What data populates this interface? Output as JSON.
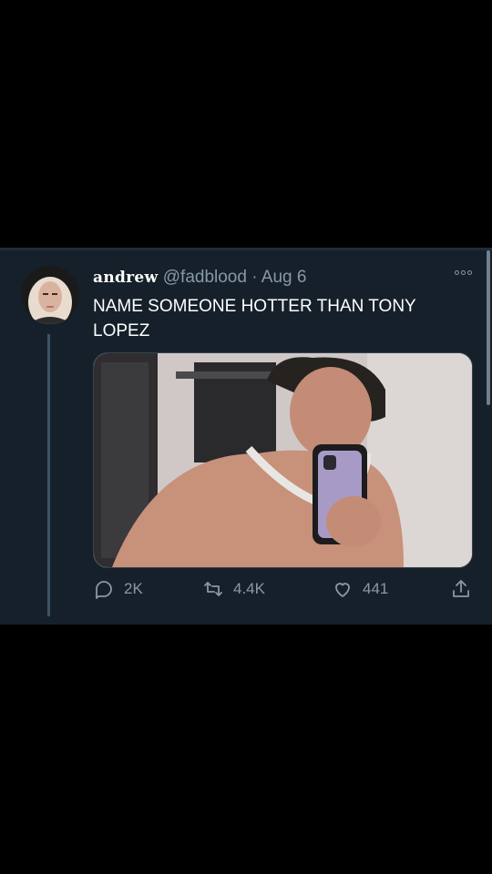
{
  "tweet": {
    "display_name": "andrew",
    "handle": "@fadblood",
    "separator": "·",
    "date": "Aug 6",
    "text": "NAME SOMEONE HOTTER THAN TONY LOPEZ",
    "media_icon": "photo",
    "more_icon": "more-dots-icon"
  },
  "actions": {
    "reply_count": "2K",
    "retweet_count": "4.4K",
    "like_count": "441",
    "reply_icon": "reply-icon",
    "retweet_icon": "retweet-icon",
    "like_icon": "heart-icon",
    "share_icon": "share-icon"
  },
  "colors": {
    "background": "#000000",
    "card": "#15202b",
    "secondary_text": "#8899a6",
    "primary_text": "#ffffff"
  }
}
